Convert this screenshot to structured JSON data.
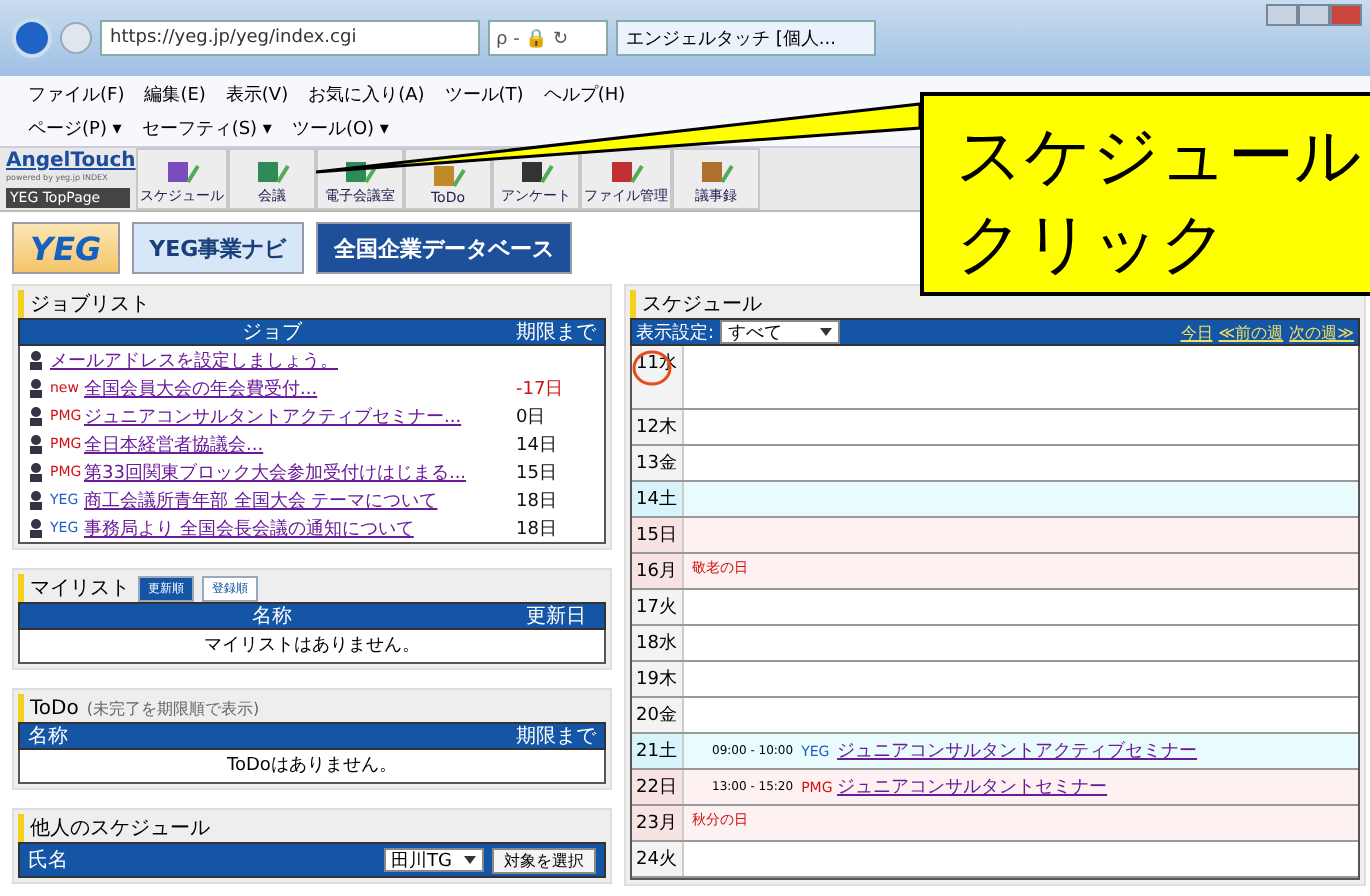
{
  "browser": {
    "address": "https://yeg.jp/yeg/index.cgi",
    "search_hint": "ρ - 🔒 ↻",
    "tab_title": "エンジェルタッチ [個人...",
    "menu": [
      "ファイル(F)",
      "編集(E)",
      "表示(V)",
      "お気に入り(A)",
      "ツール(T)",
      "ヘルプ(H)"
    ],
    "commands": [
      "ページ(P) ▾",
      "セーフティ(S) ▾",
      "ツール(O) ▾"
    ]
  },
  "app": {
    "logo": "AngelTouch",
    "logo_sub": "powered by yeg.jp INDEX",
    "toppage": "YEG TopPage",
    "tools": [
      {
        "label": "スケジュール"
      },
      {
        "label": "会議"
      },
      {
        "label": "電子会議室"
      },
      {
        "label": "ToDo"
      },
      {
        "label": "アンケート"
      },
      {
        "label": "ファイル管理"
      },
      {
        "label": "議事録"
      }
    ]
  },
  "banners": [
    {
      "kind": "yeg",
      "text": "YEG"
    },
    {
      "kind": "navi",
      "text": "YEG事業ナビ"
    },
    {
      "kind": "db",
      "text": "全国企業データベース"
    }
  ],
  "job_list": {
    "title": "ジョブリスト",
    "columns": [
      "ジョブ",
      "期限まで"
    ],
    "rows": [
      {
        "title": "メールアドレスを設定しましょう。"
      },
      {
        "tag": "new",
        "title": "全国会員大会の年会費受付...",
        "due": "-17日",
        "overdue": true
      },
      {
        "tag": "PMG",
        "title": "ジュニアコンサルタントアクティブセミナー...",
        "due": "0日",
        "overdue": false
      },
      {
        "tag": "PMG",
        "title": "全日本経営者協議会...",
        "due": "14日",
        "overdue": false
      },
      {
        "tag": "PMG",
        "title": "第33回関東ブロック大会参加受付けはじまる...",
        "due": "15日",
        "overdue": false
      },
      {
        "tag": "YEG",
        "title": "商工会議所青年部 全国大会 テーマについて",
        "due": "18日",
        "overdue": false
      },
      {
        "tag": "YEG",
        "title": "事務局より 全国会長会議の通知について",
        "due": "18日",
        "overdue": false
      }
    ]
  },
  "my_list": {
    "title": "マイリスト",
    "tabs": [
      {
        "label": "更新順",
        "selected": true
      },
      {
        "label": "登録順",
        "selected": false
      }
    ],
    "columns": [
      "名称",
      "更新日"
    ],
    "empty": "マイリストはありません。"
  },
  "todo": {
    "title": "ToDo",
    "note": "(未完了を期限順で表示)",
    "columns": [
      "名称",
      "期限まで"
    ],
    "empty": "ToDoはありません。"
  },
  "others": {
    "title": "他人のスケジュール",
    "column": "氏名",
    "select": "田川TG",
    "button": "対象を選択"
  },
  "schedule": {
    "title": "スケジュール",
    "filter_label": "表示設定:",
    "filter": "すべて",
    "links": [
      "今日",
      "≪前の週",
      "次の週≫"
    ],
    "days": [
      {
        "date": "11水",
        "kind": "weekday",
        "circled": true
      },
      {
        "date": "12木",
        "kind": "weekday",
        "circled": false
      },
      {
        "date": "13金",
        "kind": "weekday",
        "circled": false
      },
      {
        "date": "14土",
        "kind": "saturday",
        "circled": false
      },
      {
        "date": "15日",
        "kind": "sunday",
        "circled": false
      },
      {
        "date": "16月",
        "kind": "sunday",
        "circled": false,
        "holiday": "敬老の日"
      },
      {
        "date": "17火",
        "kind": "weekday",
        "circled": false
      },
      {
        "date": "18水",
        "kind": "weekday",
        "circled": false
      },
      {
        "date": "19木",
        "kind": "weekday",
        "circled": false
      },
      {
        "date": "20金",
        "kind": "weekday",
        "circled": false
      },
      {
        "date": "21土",
        "kind": "saturday",
        "circled": false,
        "events": [
          {
            "time": "09:00 - 10:00",
            "tag": "YEG",
            "title": "ジュニアコンサルタントアクティブセミナー"
          }
        ]
      },
      {
        "date": "22日",
        "kind": "sunday",
        "circled": false,
        "events": [
          {
            "time": "13:00 - 15:20",
            "tag": "PMG",
            "title": "ジュニアコンサルタントセミナー"
          }
        ]
      },
      {
        "date": "23月",
        "kind": "sunday",
        "circled": false,
        "holiday": "秋分の日"
      },
      {
        "date": "24火",
        "kind": "weekday",
        "circled": false
      }
    ]
  },
  "callout": {
    "lines": [
      "スケジュール",
      "クリック"
    ]
  }
}
